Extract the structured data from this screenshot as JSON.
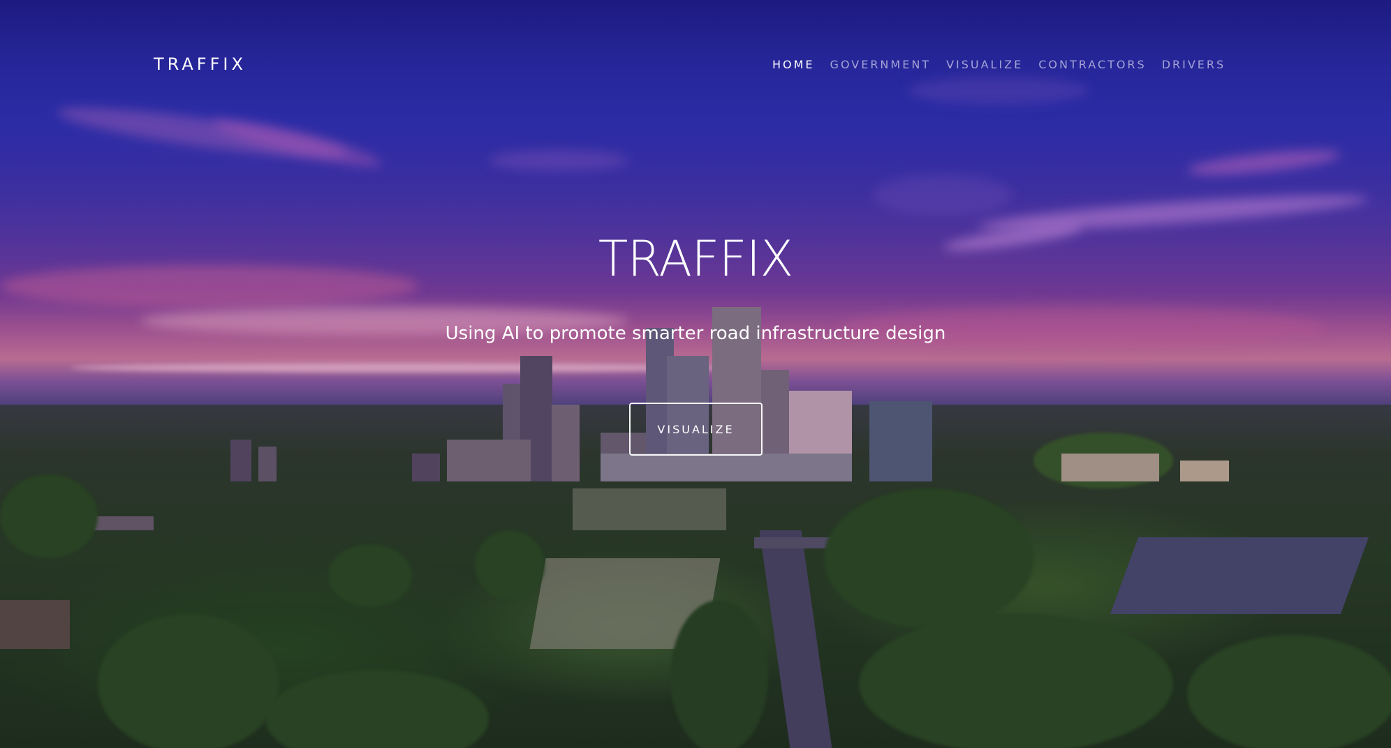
{
  "header": {
    "brand": "TRAFFIX",
    "nav": [
      {
        "label": "HOME",
        "active": true
      },
      {
        "label": "GOVERNMENT",
        "active": false
      },
      {
        "label": "VISUALIZE",
        "active": false
      },
      {
        "label": "CONTRACTORS",
        "active": false
      },
      {
        "label": "DRIVERS",
        "active": false
      }
    ]
  },
  "hero": {
    "title": "TRAFFIX",
    "subtitle": "Using AI to promote smarter road infrastructure design",
    "cta_label": "VISUALIZE"
  },
  "colors": {
    "nav_active": "#ffffff",
    "nav_inactive": "#cdcdeb",
    "sky_top": "#1f1d8a",
    "sunset": "#d07a9e"
  }
}
